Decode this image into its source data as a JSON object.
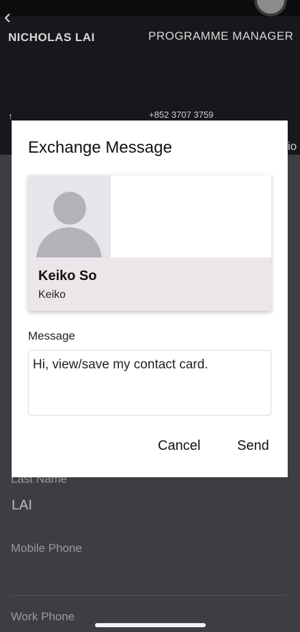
{
  "card": {
    "name": "NICHOLAS LAI",
    "title": "PROGRAMME MANAGER",
    "phone": "+852 3707 3759",
    "back_glyph": "‹"
  },
  "form": {
    "last_name_label": "Last Name",
    "last_name_value": "LAI",
    "mobile_phone_label": "Mobile Phone",
    "work_phone_label": "Work Phone"
  },
  "dialog": {
    "title": "Exchange Message",
    "contact": {
      "name": "Keiko So",
      "nickname": "Keiko"
    },
    "message_label": "Message",
    "message_value": "Hi, view/save my contact card.",
    "cancel_label": "Cancel",
    "send_label": "Send"
  },
  "colors": {
    "dialog_bg": "#ffffff",
    "overlay_bg": "#3f3d43",
    "card_info_bg": "#ece5ea"
  },
  "icons": {
    "back": "chevron-left-icon",
    "avatar": "person-placeholder-icon"
  }
}
